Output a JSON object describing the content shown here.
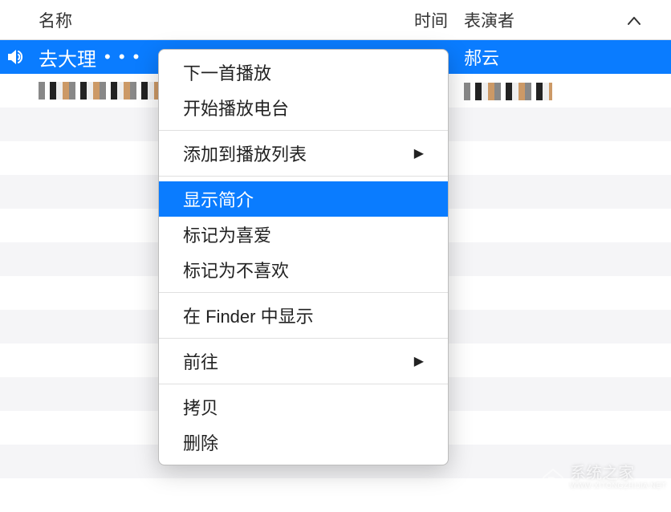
{
  "header": {
    "name": "名称",
    "time": "时间",
    "artist": "表演者"
  },
  "rows": [
    {
      "title": "去大理",
      "ellipsis": "• • •",
      "artist": "郝云",
      "selected": true,
      "playing": true
    },
    {
      "title_obscured": true,
      "artist_obscured": true
    }
  ],
  "context_menu": {
    "play_next": "下一首播放",
    "start_radio": "开始播放电台",
    "add_to_playlist": "添加到播放列表",
    "get_info": "显示简介",
    "mark_loved": "标记为喜爱",
    "mark_disliked": "标记为不喜欢",
    "show_in_finder": "在 Finder 中显示",
    "go_to": "前往",
    "copy": "拷贝",
    "delete": "删除"
  },
  "watermark": {
    "text": "系统之家",
    "url": "WWW.XITONGZHIJIA.NET"
  }
}
